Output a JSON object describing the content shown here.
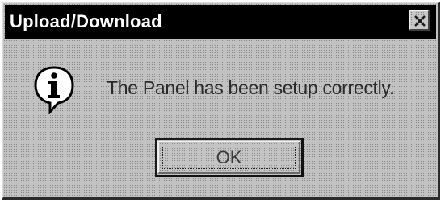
{
  "dialog": {
    "title": "Upload/Download",
    "message": "The Panel has been setup correctly.",
    "ok_label": "OK",
    "icon": "info-icon",
    "close_icon": "close-icon"
  },
  "colors": {
    "title_bar": "#000000",
    "title_text": "#ffffff",
    "dialog_face": "#c2c2c2"
  }
}
